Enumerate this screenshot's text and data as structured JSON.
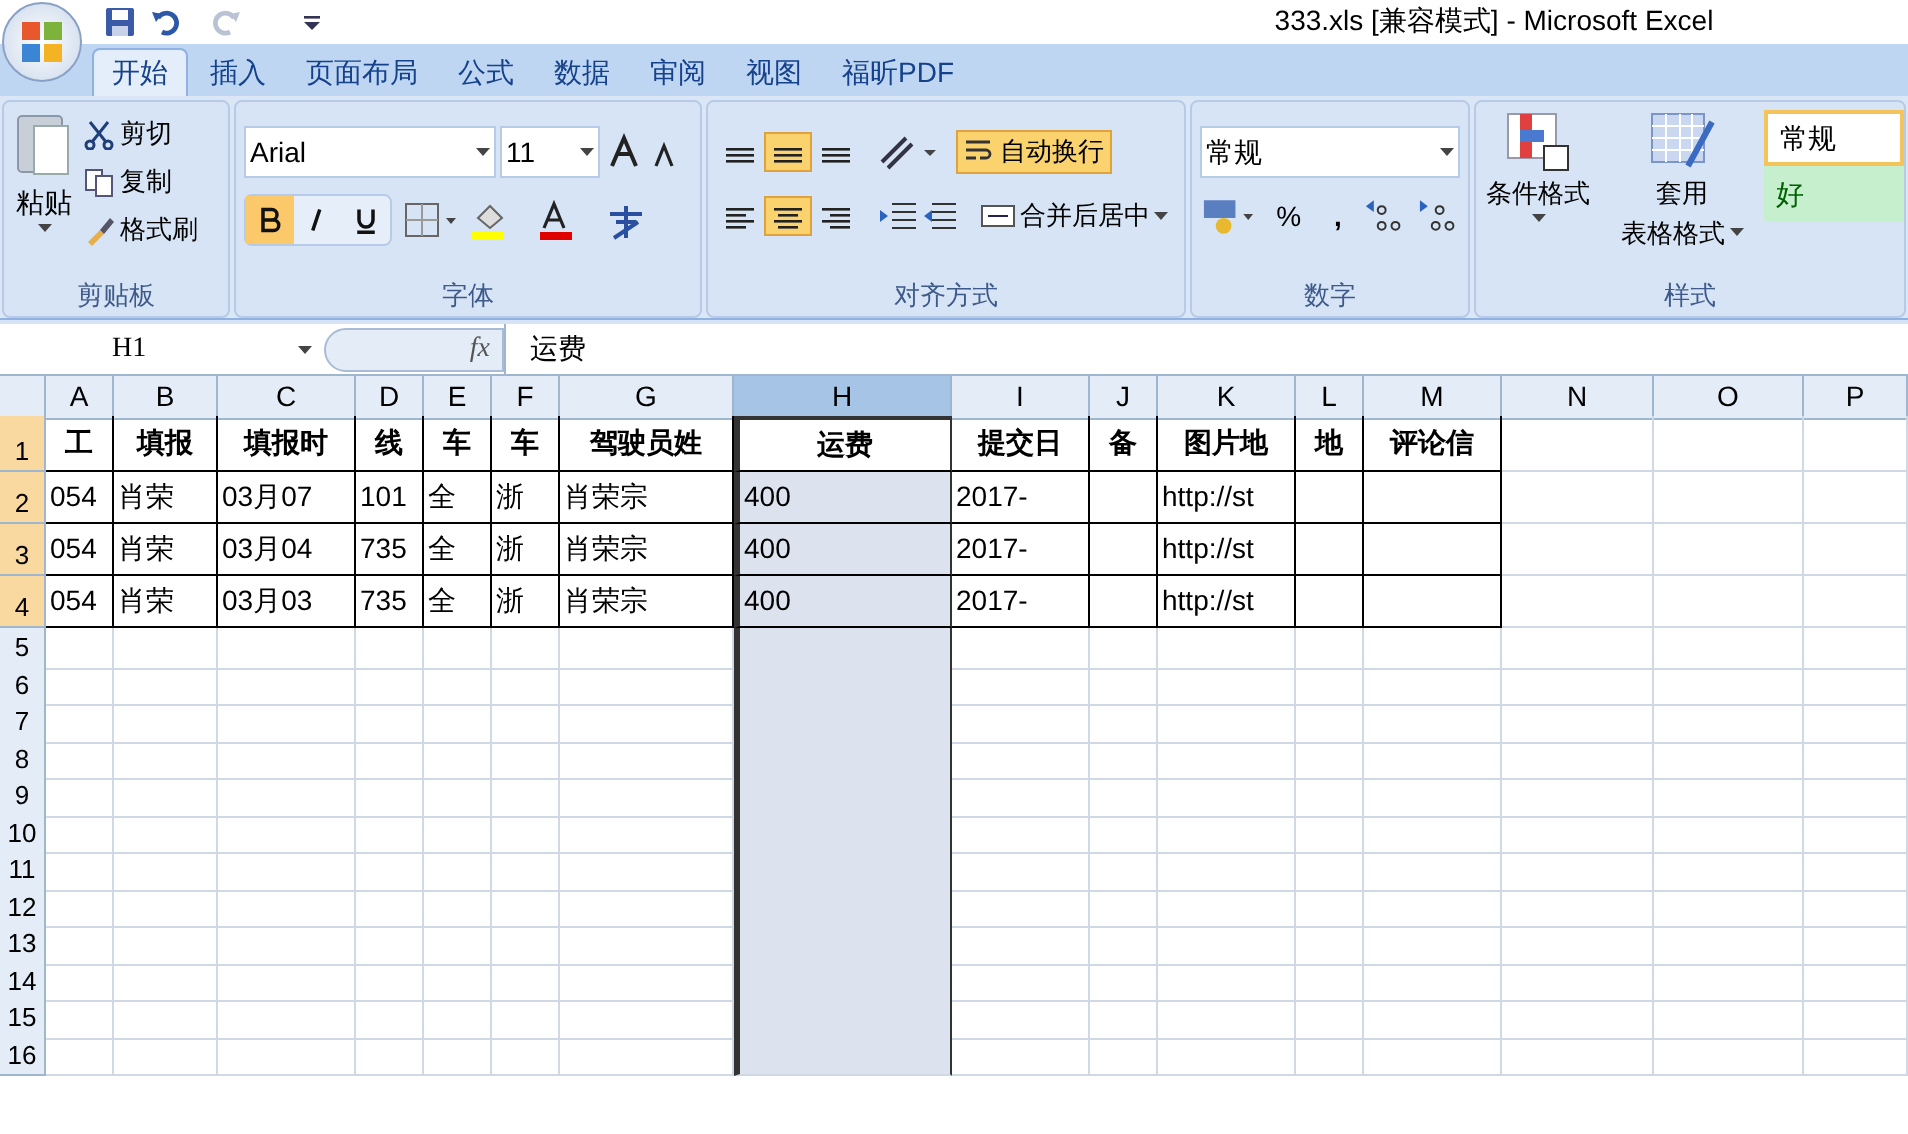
{
  "window": {
    "title": "333.xls  [兼容模式] - Microsoft Excel"
  },
  "ribbon_tabs": [
    {
      "label": "开始",
      "selected": true
    },
    {
      "label": "插入",
      "selected": false
    },
    {
      "label": "页面布局",
      "selected": false
    },
    {
      "label": "公式",
      "selected": false
    },
    {
      "label": "数据",
      "selected": false
    },
    {
      "label": "审阅",
      "selected": false
    },
    {
      "label": "视图",
      "selected": false
    },
    {
      "label": "福昕PDF",
      "selected": false
    }
  ],
  "clipboard": {
    "paste": "粘贴",
    "cut": "剪切",
    "copy": "复制",
    "format_painter": "格式刷",
    "label": "剪贴板"
  },
  "font": {
    "name": "Arial",
    "size": "11",
    "label": "字体",
    "bold": true,
    "italic": false,
    "underline": false
  },
  "alignment": {
    "vertical": [
      {
        "selected": false
      },
      {
        "selected": true
      },
      {
        "selected": false
      }
    ],
    "horizontal": [
      {
        "selected": false
      },
      {
        "selected": true
      },
      {
        "selected": false
      }
    ],
    "wrap_text": {
      "label": "自动换行",
      "selected": true
    },
    "merge": "合并后居中",
    "label": "对齐方式"
  },
  "number": {
    "format": "常规",
    "percent": "%",
    "comma": ",",
    "label": "数字"
  },
  "styles": {
    "conditional": "条件格式",
    "table_format_1": "套用",
    "table_format_2": "表格格式",
    "cell_styles": [
      {
        "label": "常规",
        "kind": "normal"
      },
      {
        "label": "好",
        "kind": "good"
      }
    ],
    "label": "样式"
  },
  "formula_bar": {
    "name_box": "H1",
    "fx": "fx",
    "value": "运费"
  },
  "sheet": {
    "columns": [
      {
        "label": "A",
        "selected": false
      },
      {
        "label": "B",
        "selected": false
      },
      {
        "label": "C",
        "selected": false
      },
      {
        "label": "D",
        "selected": false
      },
      {
        "label": "E",
        "selected": false
      },
      {
        "label": "F",
        "selected": false
      },
      {
        "label": "G",
        "selected": false
      },
      {
        "label": "H",
        "selected": true
      },
      {
        "label": "I",
        "selected": false
      },
      {
        "label": "J",
        "selected": false
      },
      {
        "label": "K",
        "selected": false
      },
      {
        "label": "L",
        "selected": false
      },
      {
        "label": "M",
        "selected": false
      },
      {
        "label": "N",
        "selected": false
      },
      {
        "label": "O",
        "selected": false
      },
      {
        "label": "P",
        "selected": false
      }
    ],
    "rows": [
      {
        "label": "1",
        "highlighted": true,
        "cells": [
          "工",
          "填报",
          "填报时",
          "线",
          "车",
          "车",
          "驾驶员姓",
          "运费",
          "提交日",
          "备",
          "图片地",
          "地",
          "评论信"
        ]
      },
      {
        "label": "2",
        "highlighted": true,
        "cells": [
          "054",
          "肖荣",
          "03月07",
          "101",
          "全",
          "浙",
          "肖荣宗",
          "400",
          "2017-",
          "",
          "http://st",
          "",
          ""
        ]
      },
      {
        "label": "3",
        "highlighted": true,
        "cells": [
          "054",
          "肖荣",
          "03月04",
          "735",
          "全",
          "浙",
          "肖荣宗",
          "400",
          "2017-",
          "",
          "http://st",
          "",
          ""
        ]
      },
      {
        "label": "4",
        "highlighted": true,
        "cells": [
          "054",
          "肖荣",
          "03月03",
          "735",
          "全",
          "浙",
          "肖荣宗",
          "400",
          "2017-",
          "",
          "http://st",
          "",
          ""
        ]
      },
      {
        "label": "5",
        "highlighted": false,
        "cells": []
      },
      {
        "label": "6",
        "highlighted": false,
        "cells": []
      },
      {
        "label": "7",
        "highlighted": false,
        "cells": []
      },
      {
        "label": "8",
        "highlighted": false,
        "cells": []
      },
      {
        "label": "9",
        "highlighted": false,
        "cells": []
      },
      {
        "label": "10",
        "highlighted": false,
        "cells": []
      },
      {
        "label": "11",
        "highlighted": false,
        "cells": []
      },
      {
        "label": "12",
        "highlighted": false,
        "cells": []
      },
      {
        "label": "13",
        "highlighted": false,
        "cells": []
      },
      {
        "label": "14",
        "highlighted": false,
        "cells": []
      },
      {
        "label": "15",
        "highlighted": false,
        "cells": []
      },
      {
        "label": "16",
        "highlighted": false,
        "cells": []
      }
    ]
  }
}
